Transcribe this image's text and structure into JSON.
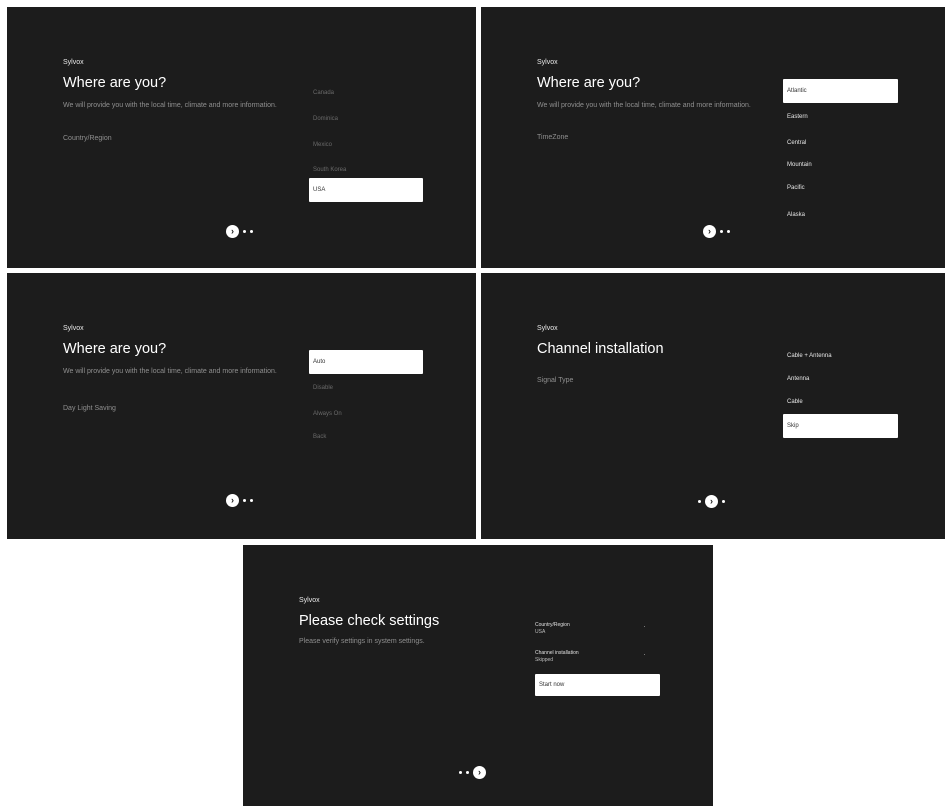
{
  "brand": "Sylvox",
  "screen1": {
    "title": "Where are you?",
    "description": "We will provide you with the local time, climate and more information.",
    "field": "Country/Region",
    "options": [
      "Canada",
      "Dominica",
      "Mexico",
      "South Korea",
      "USA"
    ],
    "selected_option": "USA"
  },
  "screen2": {
    "title": "Where are you?",
    "description": "We will provide you with the local time, climate and more information.",
    "field": "TimeZone",
    "options": [
      "Atlantic",
      "Eastern",
      "Central",
      "Mountain",
      "Pacific",
      "Alaska"
    ],
    "selected_option": "Atlantic"
  },
  "screen3": {
    "title": "Where are you?",
    "description": "We will provide you with the local time, climate and more information.",
    "field": "Day Light Saving",
    "options": [
      "Auto",
      "Disable",
      "Always On",
      "Back"
    ],
    "selected_option": "Auto"
  },
  "screen4": {
    "title": "Channel installation",
    "field": "Signal Type",
    "options": [
      "Cable + Antenna",
      "Antenna",
      "Cable",
      "Skip"
    ],
    "selected_option": "Skip"
  },
  "screen5": {
    "title": "Please check settings",
    "description": "Please verify settings in system settings.",
    "summary": [
      {
        "label": "Country/Region",
        "value": "USA"
      },
      {
        "label": "Channel installation",
        "value": "Skipped"
      }
    ],
    "action_label": "Start now"
  },
  "pager": {
    "arrow_glyph": "›"
  }
}
